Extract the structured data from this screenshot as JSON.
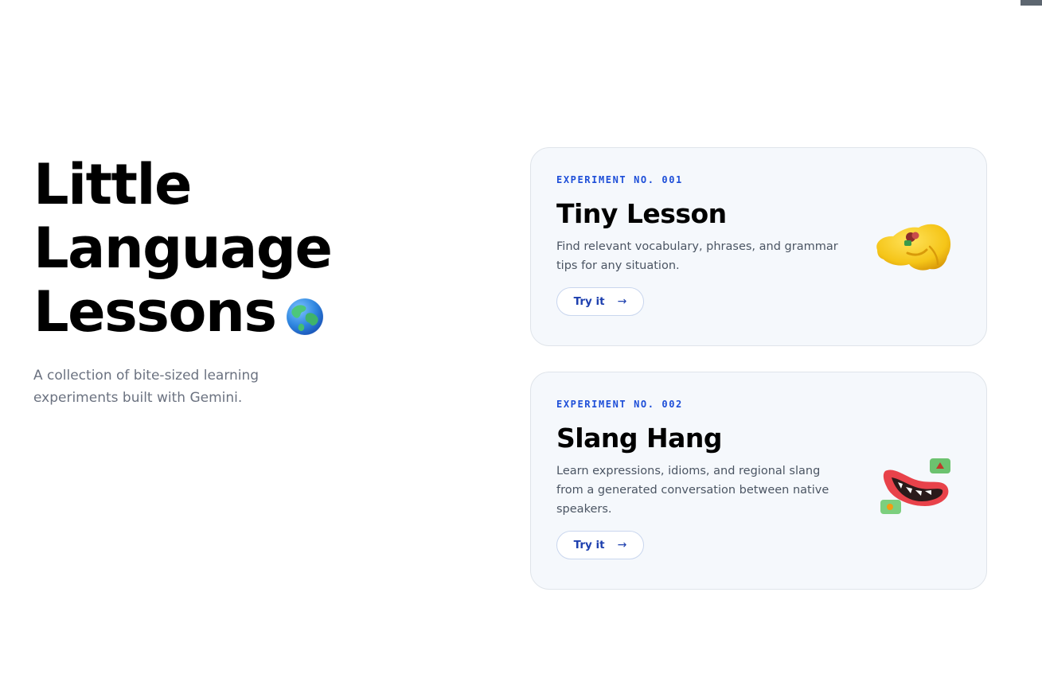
{
  "hero": {
    "title_lines": [
      "Little",
      "Language",
      "Lessons"
    ],
    "globe_icon": "globe-icon",
    "subtitle": "A collection of bite-sized learning experiments built with Gemini."
  },
  "cards": [
    {
      "tag": "EXPERIMENT NO. 001",
      "title": "Tiny Lesson",
      "description": "Find relevant vocabulary, phrases, and grammar tips for any situation.",
      "button_label": "Try it",
      "button_arrow": "→",
      "illustration_icon": "pinching-hand-icon"
    },
    {
      "tag": "EXPERIMENT NO. 002",
      "title": "Slang Hang",
      "description": "Learn expressions, idioms, and regional slang from a generated conversation between native speakers.",
      "button_label": "Try it",
      "button_arrow": "→",
      "illustration_icon": "grinning-mouth-icon"
    }
  ],
  "colors": {
    "accent": "#1d4ed8",
    "card_background": "#f5f8fc",
    "card_border": "#dfe4ea",
    "subtitle_text": "#6b7280"
  }
}
